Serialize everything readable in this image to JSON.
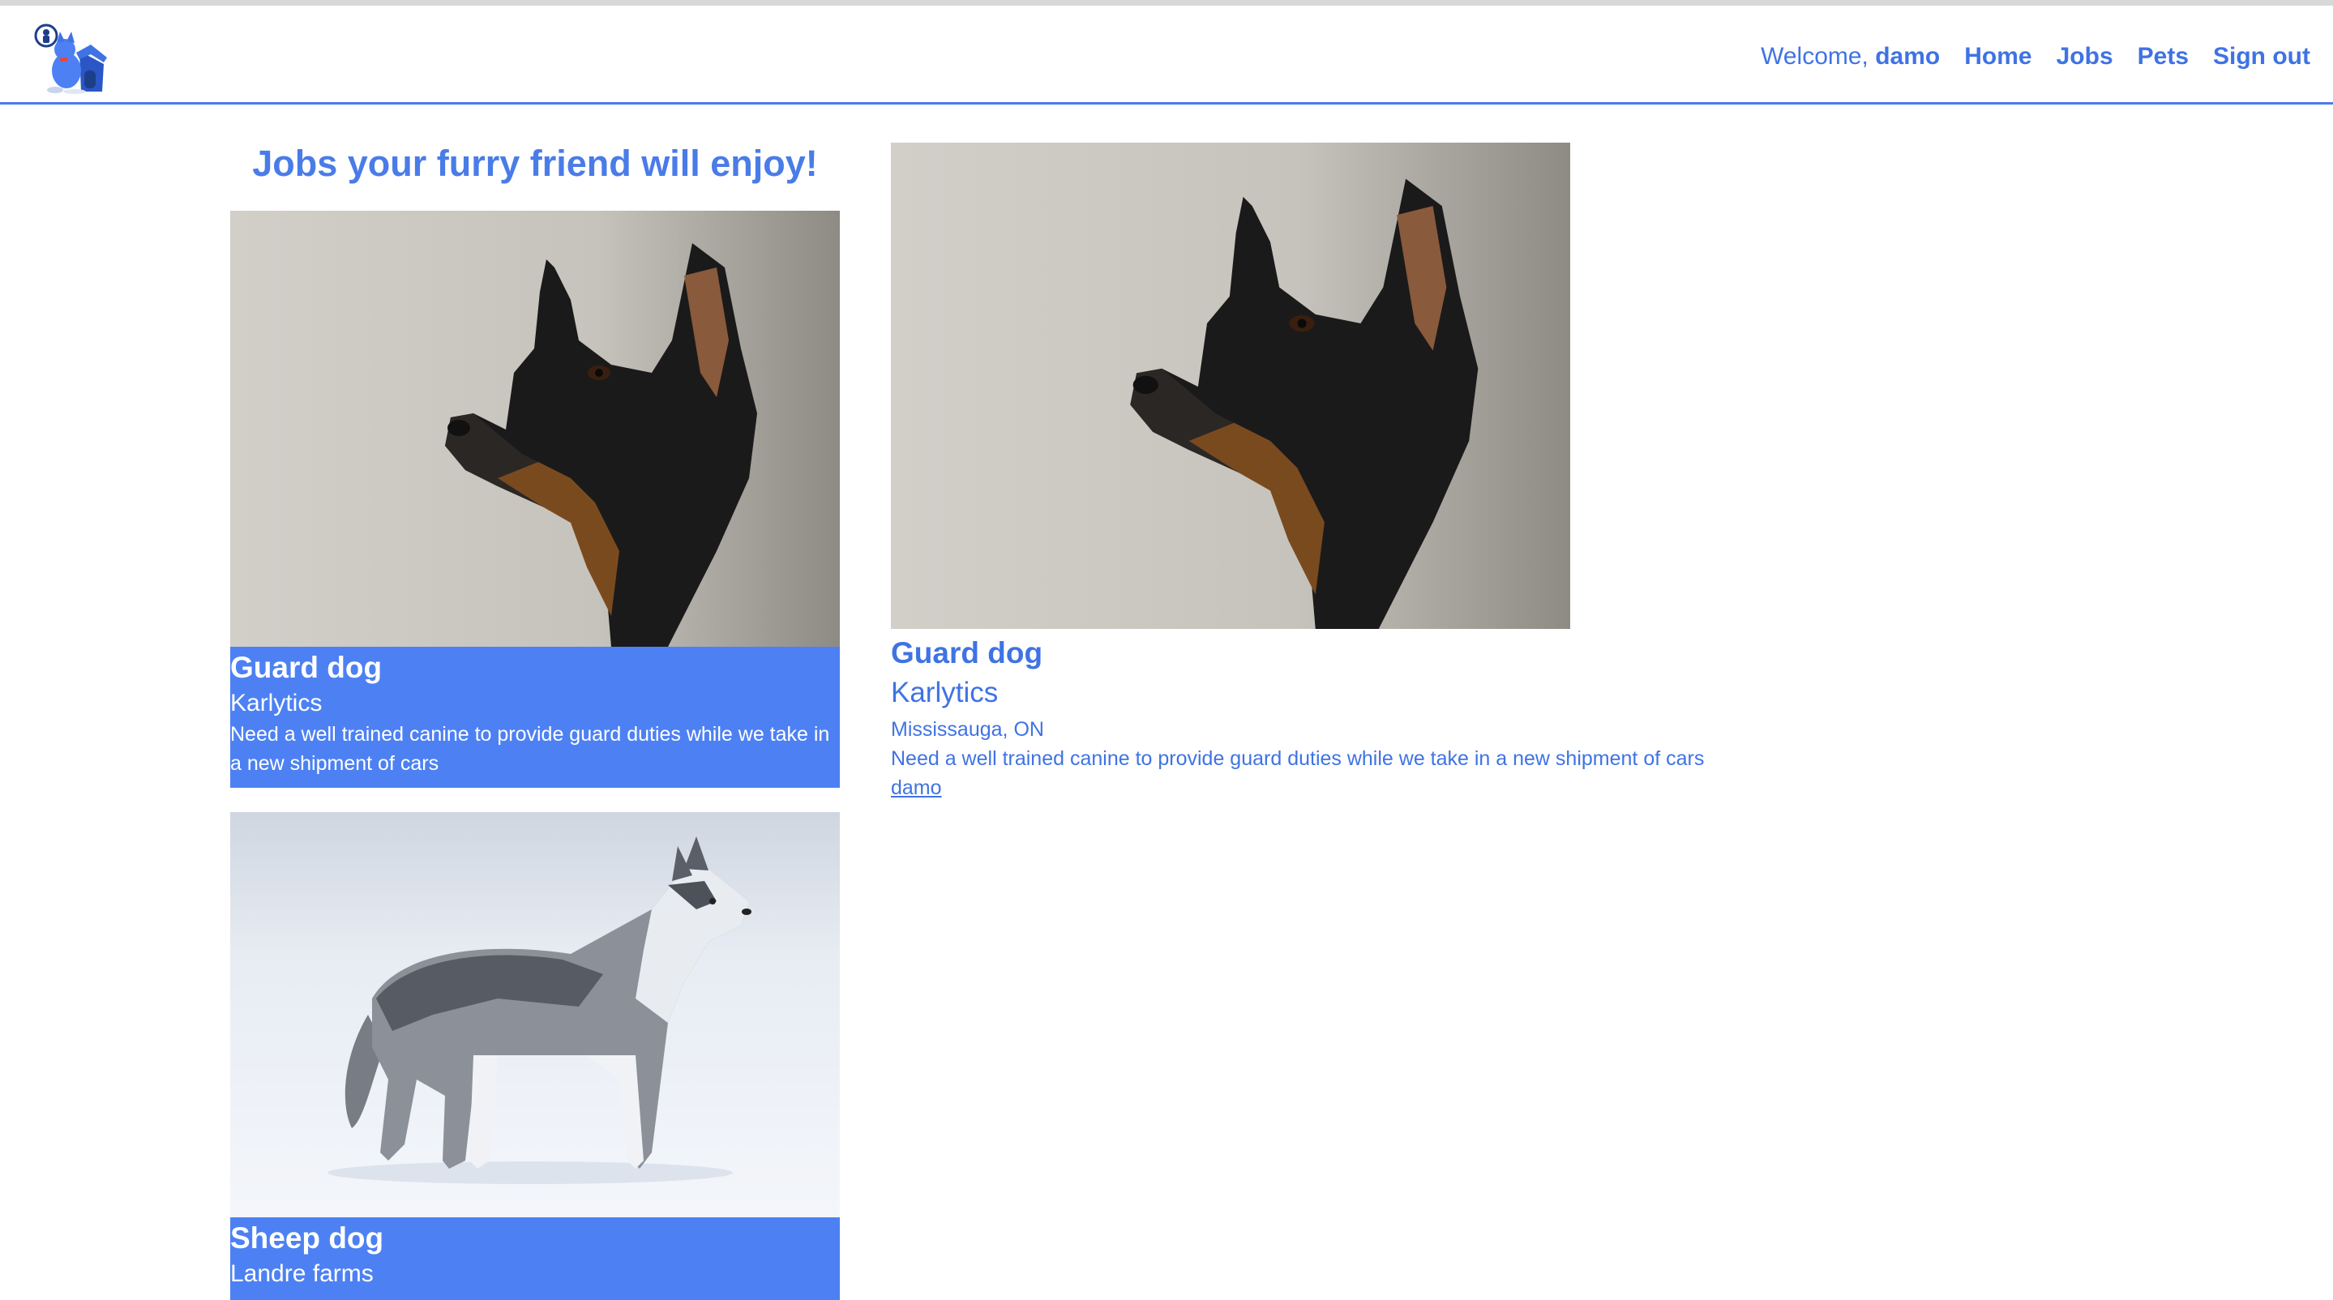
{
  "nav": {
    "welcome_prefix": "Welcome, ",
    "username": "damo",
    "links": [
      "Home",
      "Jobs",
      "Pets",
      "Sign out"
    ]
  },
  "page": {
    "title": "Jobs your furry friend will enjoy!"
  },
  "jobs": [
    {
      "title": "Guard dog",
      "company": "Karlytics",
      "description": "Need a well trained canine to provide guard duties while we take in a new shipment of cars"
    },
    {
      "title": "Sheep dog",
      "company": "Landre farms",
      "description": ""
    }
  ],
  "selected_job": {
    "title": "Guard dog",
    "company": "Karlytics",
    "location": "Mississauga, ON",
    "description": "Need a well trained canine to provide guard duties while we take in a new shipment of cars",
    "posted_by": "damo"
  },
  "colors": {
    "accent": "#4a7ce8",
    "card_bg": "#4d81f3"
  }
}
